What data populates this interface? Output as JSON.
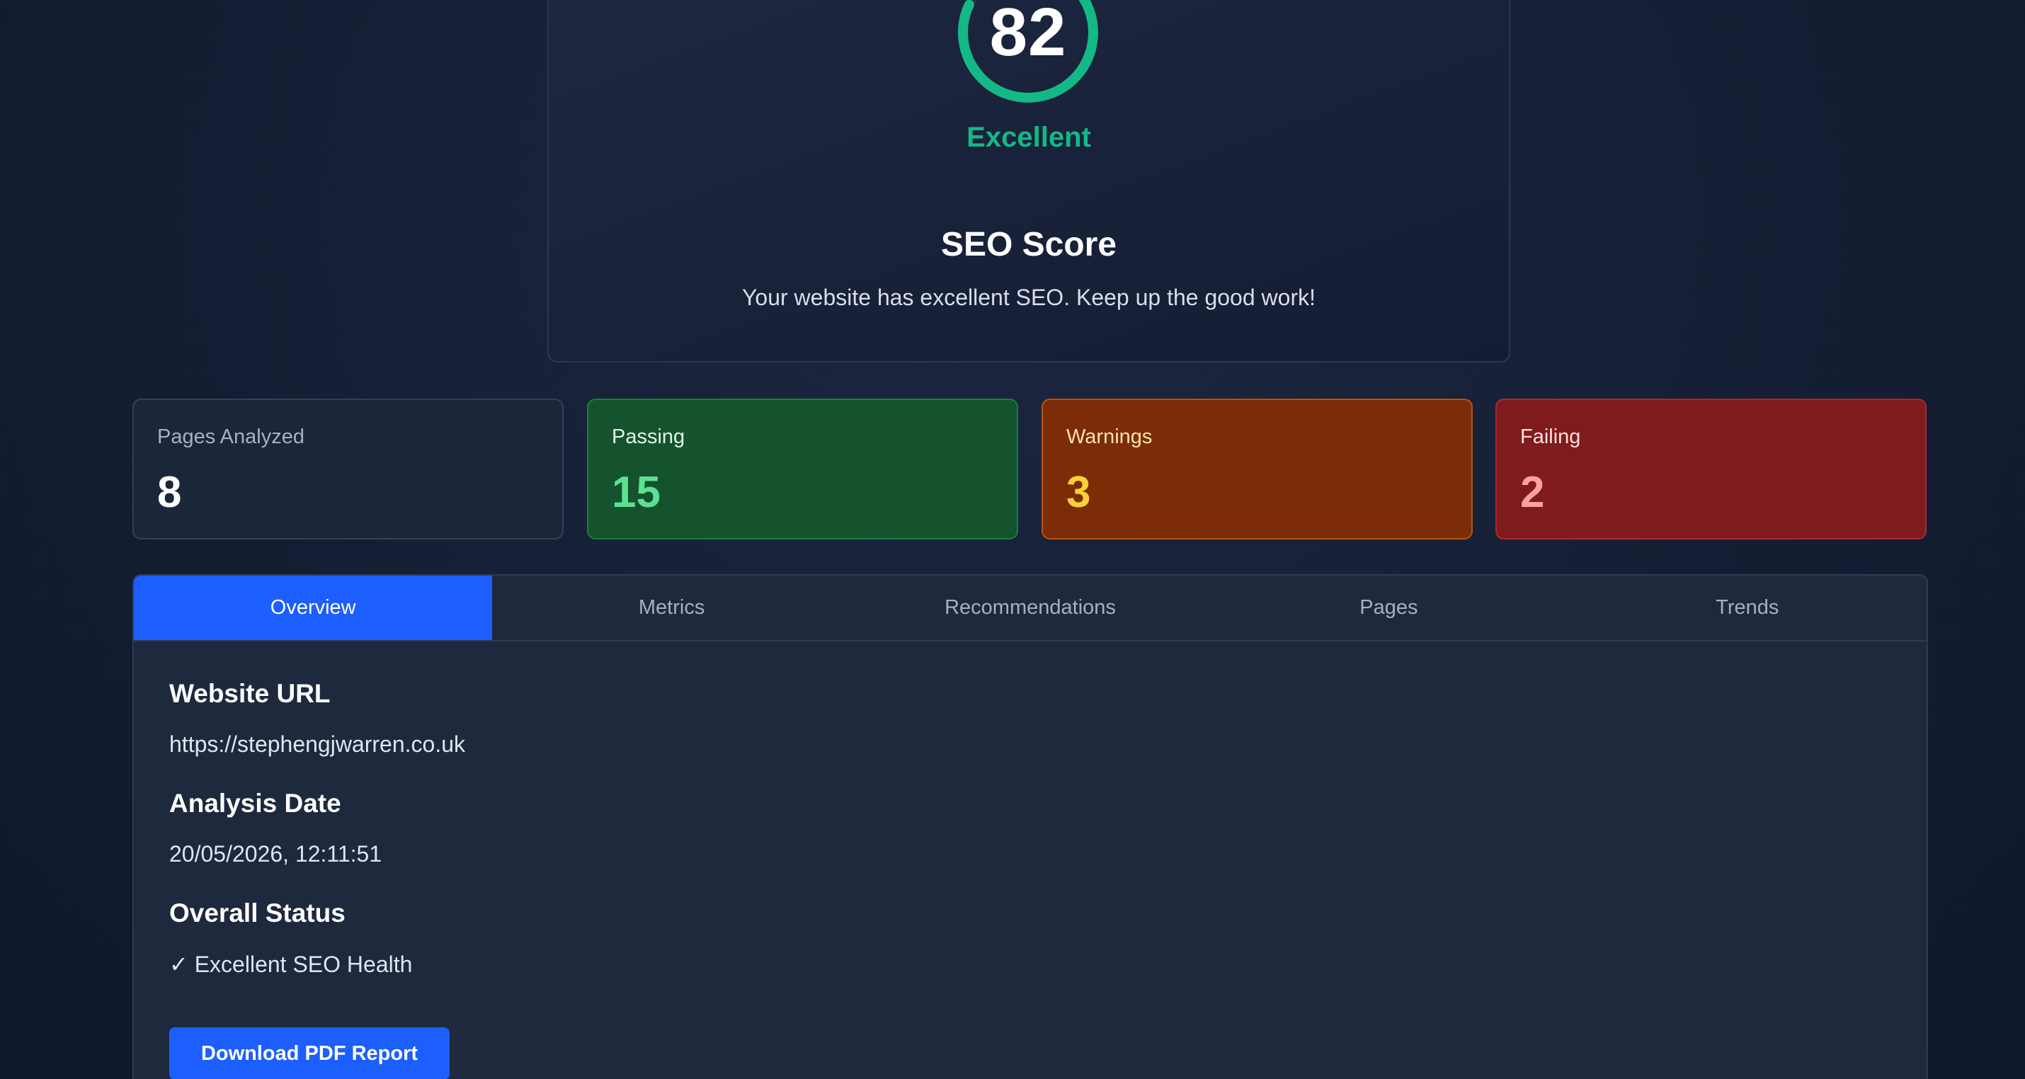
{
  "score": {
    "value": "82",
    "percent": 82,
    "rating": "Excellent",
    "title": "SEO Score",
    "description": "Your website has excellent SEO. Keep up the good work!",
    "ring_color": "#14b886"
  },
  "stats": {
    "pages": {
      "label": "Pages Analyzed",
      "value": "8"
    },
    "passing": {
      "label": "Passing",
      "value": "15"
    },
    "warnings": {
      "label": "Warnings",
      "value": "3"
    },
    "failing": {
      "label": "Failing",
      "value": "2"
    }
  },
  "tabs": [
    {
      "label": "Overview",
      "active": true
    },
    {
      "label": "Metrics",
      "active": false
    },
    {
      "label": "Recommendations",
      "active": false
    },
    {
      "label": "Pages",
      "active": false
    },
    {
      "label": "Trends",
      "active": false
    }
  ],
  "overview": {
    "url_title": "Website URL",
    "url_value": "https://stephengjwarren.co.uk",
    "date_title": "Analysis Date",
    "date_value": "20/05/2026, 12:11:51",
    "status_title": "Overall Status",
    "status_value": "✓ Excellent SEO Health",
    "download_label": "Download PDF Report"
  }
}
